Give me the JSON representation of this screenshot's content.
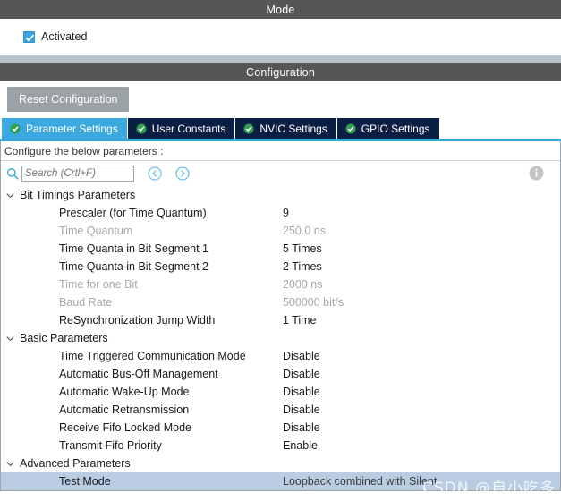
{
  "mode": {
    "header": "Mode",
    "activated_label": "Activated",
    "activated_checked": true
  },
  "configuration": {
    "header": "Configuration",
    "reset_button": "Reset Configuration",
    "tabs": [
      {
        "label": "Parameter Settings",
        "icon": "check-circle-icon",
        "active": true
      },
      {
        "label": "User Constants",
        "icon": "check-circle-icon",
        "active": false
      },
      {
        "label": "NVIC Settings",
        "icon": "check-circle-icon",
        "active": false
      },
      {
        "label": "GPIO Settings",
        "icon": "check-circle-icon",
        "active": false
      }
    ]
  },
  "params_panel": {
    "note": "Configure the below parameters :",
    "search": {
      "placeholder": "Search (Crtl+F)",
      "value": "",
      "icon": "search-icon",
      "prev_icon": "chevron-left-circle-icon",
      "next_icon": "chevron-right-circle-icon"
    },
    "info_icon": "info-icon",
    "groups": [
      {
        "label": "Bit Timings Parameters",
        "expanded": true,
        "rows": [
          {
            "name": "Prescaler (for Time Quantum)",
            "value": "9",
            "dim": false,
            "selected": false
          },
          {
            "name": "Time Quantum",
            "value": "250.0 ns",
            "dim": true,
            "selected": false
          },
          {
            "name": "Time Quanta in Bit Segment 1",
            "value": "5 Times",
            "dim": false,
            "selected": false
          },
          {
            "name": "Time Quanta in Bit Segment 2",
            "value": "2 Times",
            "dim": false,
            "selected": false
          },
          {
            "name": "Time for one Bit",
            "value": "2000 ns",
            "dim": true,
            "selected": false
          },
          {
            "name": "Baud Rate",
            "value": "500000 bit/s",
            "dim": true,
            "selected": false
          },
          {
            "name": "ReSynchronization Jump Width",
            "value": "1 Time",
            "dim": false,
            "selected": false
          }
        ]
      },
      {
        "label": "Basic Parameters",
        "expanded": true,
        "rows": [
          {
            "name": "Time Triggered Communication Mode",
            "value": "Disable",
            "dim": false,
            "selected": false
          },
          {
            "name": "Automatic Bus-Off Management",
            "value": "Disable",
            "dim": false,
            "selected": false
          },
          {
            "name": "Automatic Wake-Up Mode",
            "value": "Disable",
            "dim": false,
            "selected": false
          },
          {
            "name": "Automatic Retransmission",
            "value": "Disable",
            "dim": false,
            "selected": false
          },
          {
            "name": "Receive Fifo Locked Mode",
            "value": "Disable",
            "dim": false,
            "selected": false
          },
          {
            "name": "Transmit Fifo Priority",
            "value": "Enable",
            "dim": false,
            "selected": false
          }
        ]
      },
      {
        "label": "Advanced Parameters",
        "expanded": true,
        "rows": [
          {
            "name": "Test Mode",
            "value": "Loopback combined with Silent",
            "dim": false,
            "selected": true
          }
        ]
      }
    ]
  },
  "watermark": "CSDN @自小吃多",
  "colors": {
    "header_bar": "#565656",
    "accent": "#3aa9e0",
    "tab_inactive": "#0b1f44",
    "selection": "#b9cce2",
    "separator": "#b6c4ca"
  }
}
